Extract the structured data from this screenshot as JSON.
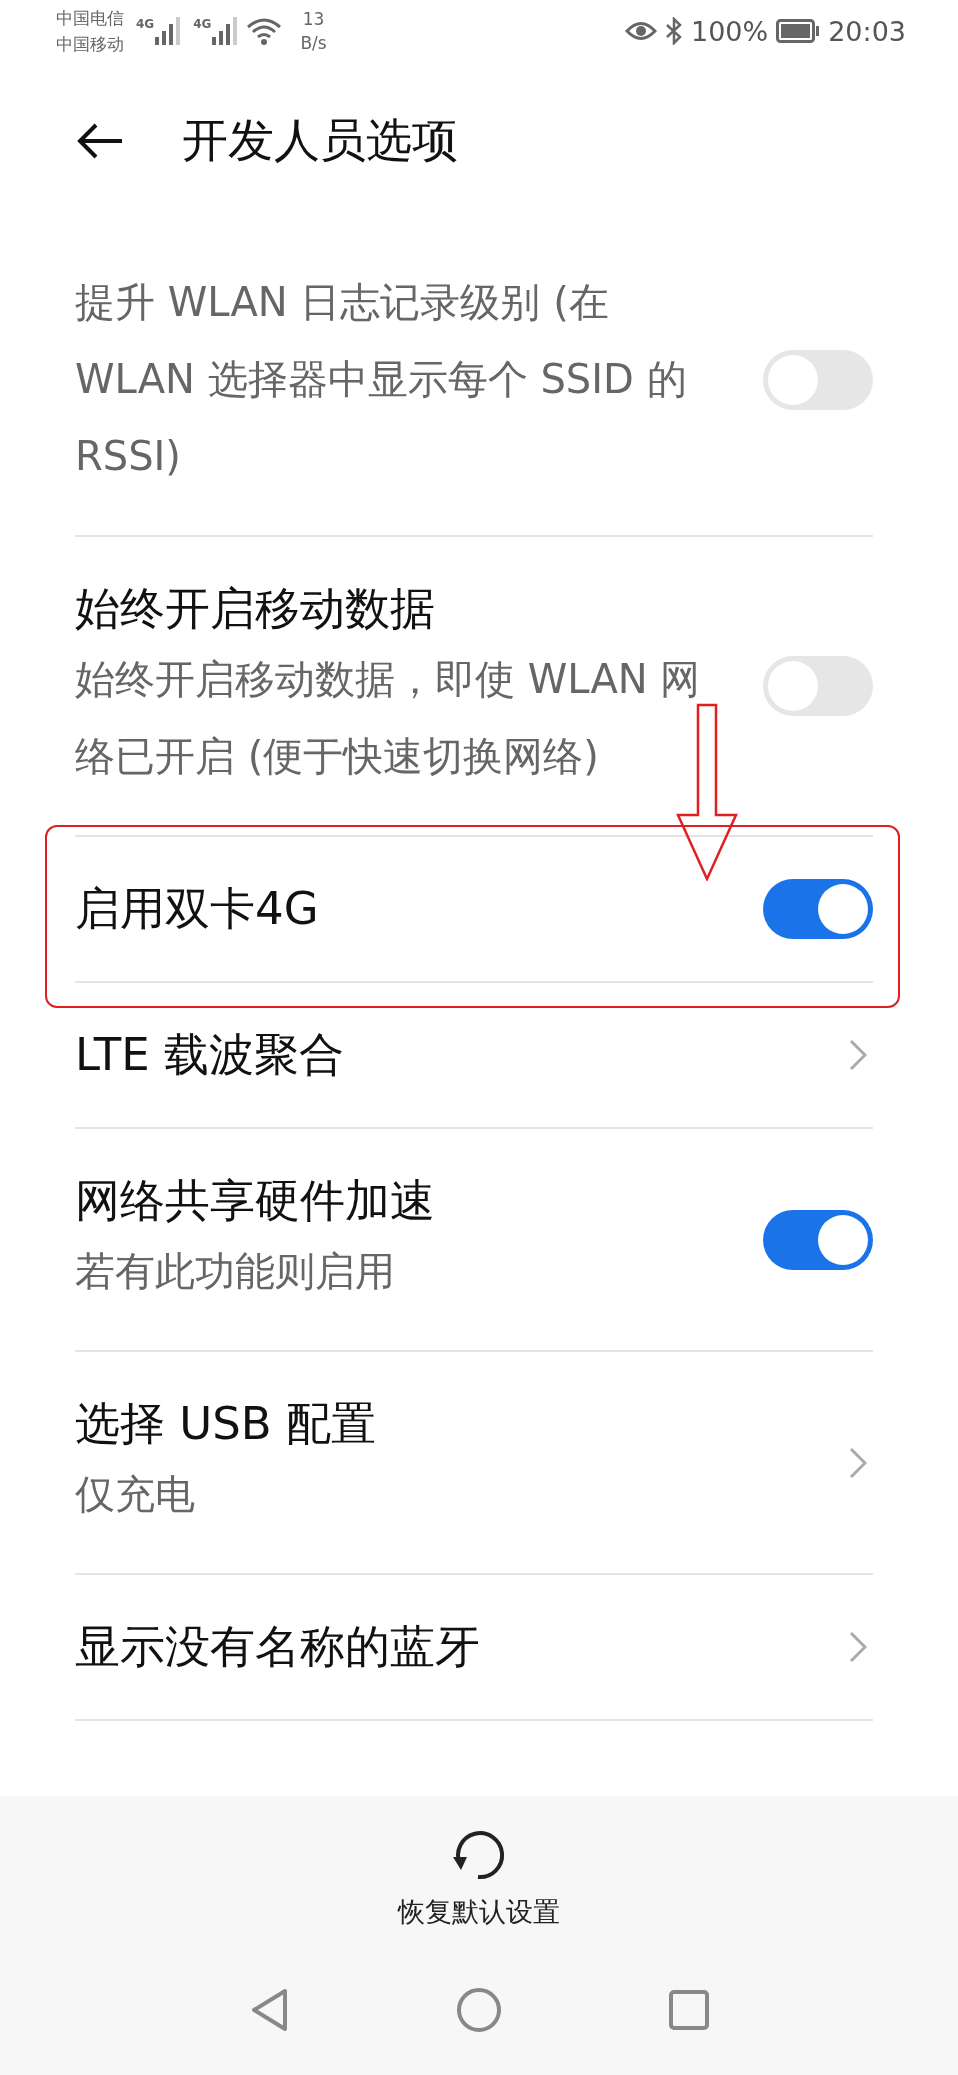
{
  "status_bar": {
    "carriers": [
      "中国电信",
      "中国移动"
    ],
    "signals": [
      "4G",
      "4G"
    ],
    "speed": "13",
    "speed_unit": "B/s",
    "battery": "100%",
    "time": "20:03"
  },
  "header": {
    "title": "开发人员选项"
  },
  "settings": [
    {
      "kind": "toggle",
      "subtitle": "提升 WLAN 日志记录级别 (在 WLAN 选择器中显示每个 SSID 的 RSSI)",
      "on": false,
      "highlighted": false
    },
    {
      "kind": "toggle",
      "title": "始终开启移动数据",
      "subtitle": "始终开启移动数据，即使 WLAN 网络已开启 (便于快速切换网络)",
      "on": false,
      "highlighted": false
    },
    {
      "kind": "toggle",
      "title": "启用双卡4G",
      "on": true,
      "highlighted": true
    },
    {
      "kind": "link",
      "title": "LTE 载波聚合",
      "highlighted": false
    },
    {
      "kind": "toggle",
      "title": "网络共享硬件加速",
      "subtitle": "若有此功能则启用",
      "on": true,
      "highlighted": false
    },
    {
      "kind": "link",
      "title": "选择 USB 配置",
      "subtitle": "仅充电",
      "highlighted": false
    },
    {
      "kind": "link",
      "title": "显示没有名称的蓝牙",
      "highlighted": false
    }
  ],
  "footer": {
    "reset_label": "恢复默认设置"
  }
}
